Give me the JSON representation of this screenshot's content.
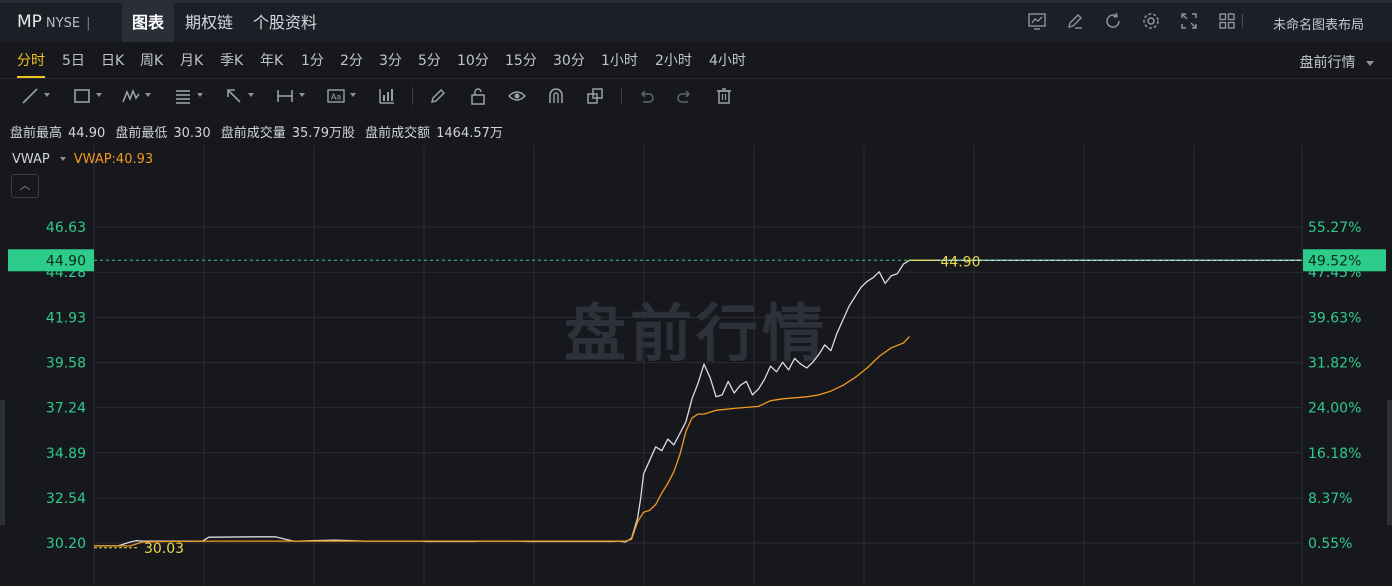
{
  "header": {
    "symbol": "MP",
    "exchange": "NYSE",
    "separator": "|",
    "tabs": [
      {
        "label": "图表",
        "active": true
      },
      {
        "label": "期权链",
        "active": false
      },
      {
        "label": "个股资料",
        "active": false
      }
    ],
    "icons": [
      "indicator-icon",
      "edit-icon",
      "refresh-icon",
      "settings-icon",
      "fullscreen-icon",
      "grid-layout-icon"
    ],
    "layout_name": "未命名图表布局"
  },
  "periods": {
    "items": [
      "分时",
      "5日",
      "日K",
      "周K",
      "月K",
      "季K",
      "年K",
      "1分",
      "2分",
      "3分",
      "5分",
      "10分",
      "15分",
      "30分",
      "1小时",
      "2小时",
      "4小时"
    ],
    "active": "分时",
    "session_select": "盘前行情"
  },
  "toolbar": {
    "tools": [
      "line-tool-icon",
      "rectangle-tool-icon",
      "wave-tool-icon",
      "fib-tool-icon",
      "arrow-tool-icon",
      "measure-tool-icon",
      "text-tool-icon",
      "indicator-tool-icon",
      "pen-icon",
      "unlock-icon",
      "eye-icon",
      "magnet-icon",
      "clone-icon",
      "undo-icon",
      "redo-icon",
      "delete-icon"
    ]
  },
  "stats": {
    "high_label": "盘前最高",
    "high_value": "44.90",
    "low_label": "盘前最低",
    "low_value": "30.30",
    "volume_label": "盘前成交量",
    "volume_value": "35.79万股",
    "amount_label": "盘前成交额",
    "amount_value": "1464.57万"
  },
  "vwap": {
    "label": "VWAP",
    "value_text": "VWAP:40.93"
  },
  "colors": {
    "price_line": "#d9dbe0",
    "vwap_line": "#f19a1e",
    "up_green": "#2ecc8a",
    "label_yellow": "#e8d84a",
    "grid": "#2a2d34"
  },
  "chart_data": {
    "type": "line",
    "watermark": "盘前行情",
    "x_index_range": [
      0,
      200
    ],
    "ylim": [
      29.6,
      47.9
    ],
    "y_ticks": [
      30.2,
      32.54,
      34.89,
      37.24,
      39.58,
      41.93,
      44.28,
      46.63
    ],
    "y_tick_labels": [
      "30.20",
      "32.54",
      "34.89",
      "37.24",
      "39.58",
      "41.93",
      "44.28",
      "46.63"
    ],
    "pct_tick_labels": [
      "0.55%",
      "8.37%",
      "16.18%",
      "24.00%",
      "31.82%",
      "39.63%",
      "47.45%",
      "55.27%"
    ],
    "current_price": 44.9,
    "current_price_label": "44.90",
    "current_pct_label": "49.52%",
    "low_price_label": "30.03",
    "series": [
      {
        "name": "price",
        "x": [
          0,
          3,
          4,
          6,
          7,
          8,
          10,
          14,
          16,
          18,
          19,
          20,
          27,
          30,
          33,
          34,
          36,
          40,
          45,
          54,
          55,
          60,
          63,
          64,
          70,
          72,
          75,
          80,
          86,
          87,
          88,
          89,
          90,
          90.5,
          91,
          92,
          93,
          94,
          95,
          96,
          97,
          98,
          99,
          100,
          101,
          102,
          103,
          104,
          105,
          106,
          107,
          108,
          109,
          110,
          111,
          112,
          113,
          114,
          115,
          116,
          117,
          118,
          119,
          120,
          121,
          122,
          123,
          124,
          125,
          126,
          127,
          128,
          129,
          130,
          131,
          132,
          133,
          134,
          135,
          200
        ],
        "values": [
          30.05,
          30.05,
          30.05,
          30.25,
          30.32,
          30.3,
          30.3,
          30.3,
          30.3,
          30.3,
          30.5,
          30.5,
          30.52,
          30.52,
          30.3,
          30.3,
          30.32,
          30.35,
          30.3,
          30.3,
          30.28,
          30.28,
          30.28,
          30.3,
          30.3,
          30.28,
          30.28,
          30.28,
          30.28,
          30.3,
          30.25,
          30.45,
          31.5,
          32.5,
          33.8,
          34.5,
          35.2,
          35.0,
          35.6,
          35.3,
          35.9,
          36.5,
          37.7,
          38.5,
          39.5,
          38.8,
          37.8,
          37.9,
          38.6,
          38.0,
          38.4,
          38.6,
          37.9,
          38.2,
          38.7,
          39.4,
          39.1,
          39.6,
          39.2,
          39.8,
          39.5,
          39.3,
          39.6,
          40.0,
          40.5,
          40.2,
          41.1,
          41.8,
          42.5,
          43.0,
          43.5,
          43.8,
          44.0,
          44.3,
          43.7,
          44.1,
          44.2,
          44.7,
          44.9,
          44.9
        ]
      },
      {
        "name": "VWAP",
        "x": [
          0,
          6,
          8,
          12,
          20,
          30,
          40,
          60,
          80,
          88,
          89,
          90,
          91,
          92,
          93,
          94,
          95,
          96,
          97,
          98,
          99,
          100,
          101,
          103,
          106,
          110,
          112,
          114,
          116,
          118,
          120,
          122,
          124,
          126,
          128,
          130,
          132,
          134,
          135
        ],
        "values": [
          30.05,
          30.05,
          30.25,
          30.28,
          30.3,
          30.3,
          30.3,
          30.3,
          30.3,
          30.3,
          30.4,
          31.3,
          31.8,
          31.9,
          32.2,
          32.8,
          33.3,
          33.9,
          34.8,
          36.0,
          36.7,
          36.9,
          36.9,
          37.1,
          37.2,
          37.3,
          37.6,
          37.7,
          37.75,
          37.8,
          37.9,
          38.1,
          38.4,
          38.8,
          39.3,
          39.9,
          40.35,
          40.6,
          40.93
        ]
      }
    ]
  }
}
